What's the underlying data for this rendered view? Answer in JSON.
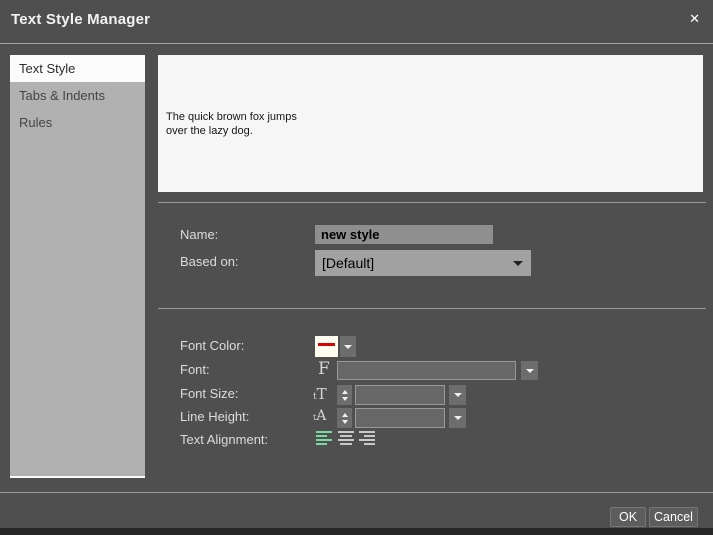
{
  "dialog": {
    "title": "Text Style Manager",
    "close_glyph": "✕"
  },
  "sidebar": {
    "items": [
      {
        "label": "Text Style"
      },
      {
        "label": "Tabs & Indents"
      },
      {
        "label": "Rules"
      }
    ],
    "selected": "Text Style"
  },
  "preview": {
    "text_line1": "The quick brown fox jumps",
    "text_line2": "over the lazy dog."
  },
  "form": {
    "name": {
      "label": "Name:",
      "value": "new style"
    },
    "based_on": {
      "label": "Based on:",
      "value": "[Default]"
    },
    "font_color": {
      "label": "Font Color:"
    },
    "font": {
      "label": "Font:",
      "value": "",
      "icon_glyph": "F"
    },
    "font_size": {
      "label": "Font Size:",
      "value": "",
      "icon_glyph": "tT"
    },
    "line_height": {
      "label": "Line Height:",
      "value": "",
      "icon_glyph": "tA"
    },
    "text_alignment": {
      "label": "Text Alignment:",
      "selected": "left",
      "options": [
        "left",
        "center",
        "right"
      ]
    }
  },
  "footer": {
    "ok_label": "OK",
    "cancel_label": "Cancel"
  },
  "colors": {
    "accent_green": "#7dd8a0",
    "swatch_red": "#d40505"
  }
}
